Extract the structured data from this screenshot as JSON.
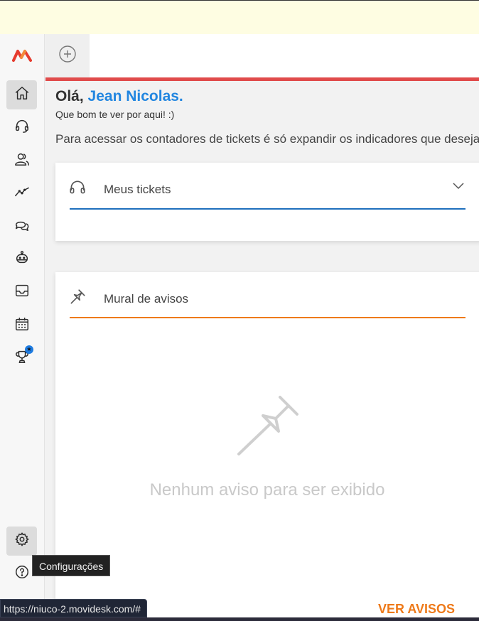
{
  "sidebar": {
    "logo": "movidesk-logo",
    "items": [
      {
        "id": "home",
        "icon": "home-icon",
        "active": true
      },
      {
        "id": "tickets",
        "icon": "headset-icon"
      },
      {
        "id": "clients",
        "icon": "users-icon"
      },
      {
        "id": "reports",
        "icon": "trend-line-icon"
      },
      {
        "id": "chat",
        "icon": "chat-bubbles-icon"
      },
      {
        "id": "bot",
        "icon": "robot-icon"
      },
      {
        "id": "inbox",
        "icon": "inbox-tray-icon"
      },
      {
        "id": "calendar",
        "icon": "calendar-icon"
      },
      {
        "id": "gamification",
        "icon": "trophy-icon",
        "badge": "★"
      }
    ],
    "bottom_items": [
      {
        "id": "settings",
        "icon": "gear-icon",
        "active": true
      },
      {
        "id": "help",
        "icon": "help-circle-icon"
      }
    ]
  },
  "tabbar": {
    "new_tab_icon": "plus-circle-icon",
    "accent_color": "#e04b4b"
  },
  "greeting": {
    "hello": "Olá,",
    "name": "Jean Nicolas.",
    "subtitle": "Que bom te ver por aqui! :)",
    "info": "Para acessar os contadores de tickets é só expandir os indicadores que desejar."
  },
  "tickets_card": {
    "title": "Meus tickets",
    "icon": "headset-icon",
    "rule_color": "#1f6fbd",
    "expand_icon": "chevron-down-icon"
  },
  "notices_card": {
    "title": "Mural de avisos",
    "icon": "pushpin-icon",
    "rule_color": "#ee7a1a",
    "empty_icon": "pushpin-icon",
    "empty_text": "Nenhum aviso para ser exibido",
    "action_label": "VER AVISOS"
  },
  "tooltip": "Configurações",
  "status_url": "https://niuco-2.movidesk.com/#",
  "colors": {
    "brand_blue": "#2286e0",
    "brand_orange": "#ee7a1a",
    "banner": "#fefde2"
  }
}
